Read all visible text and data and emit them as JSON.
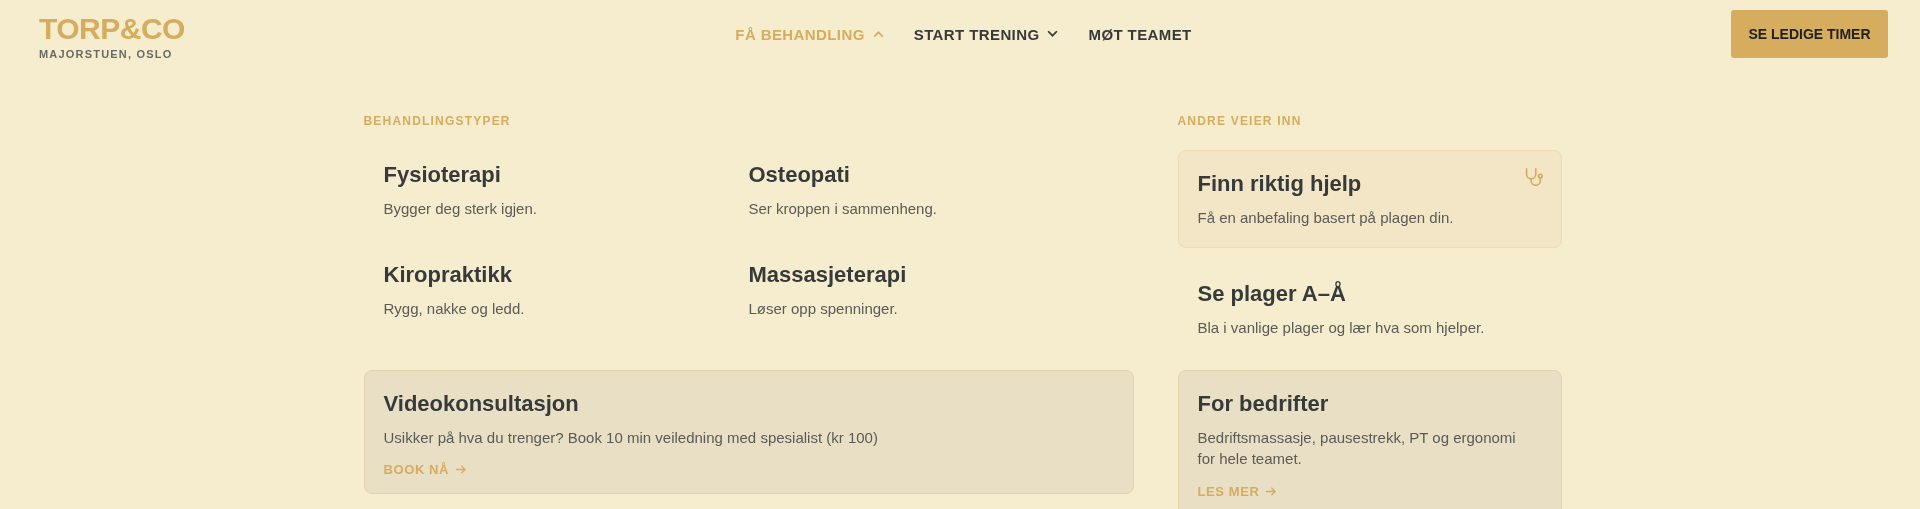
{
  "header": {
    "logo": "TORP&CO",
    "location": "MAJORSTUEN, OSLO",
    "nav": [
      {
        "label": "FÅ BEHANDLING",
        "kind": "dropdown",
        "selected": true,
        "expanded": true
      },
      {
        "label": "START TRENING",
        "kind": "dropdown",
        "selected": false,
        "expanded": false
      },
      {
        "label": "MØT TEAMET",
        "kind": "link",
        "selected": false
      }
    ],
    "cta": "SE LEDIGE TIMER"
  },
  "menu": {
    "treatments": {
      "heading": "BEHANDLINGSTYPER",
      "items": [
        {
          "title": "Fysioterapi",
          "text": "Bygger deg sterk igjen."
        },
        {
          "title": "Osteopati",
          "text": "Ser kroppen i sammenheng."
        },
        {
          "title": "Kiropraktikk",
          "text": "Rygg, nakke og ledd."
        },
        {
          "title": "Massasjeterapi",
          "text": "Løser opp spenninger."
        }
      ],
      "feature": {
        "title": "Videokonsultasjon",
        "text": "Usikker på hva du trenger? Book 10 min veiledning med spesialist (kr 100)",
        "link": "BOOK NÅ"
      }
    },
    "other": {
      "heading": "ANDRE VEIER INN",
      "items": [
        {
          "kind": "outlined",
          "title": "Finn riktig hjelp",
          "text": "Få en anbefaling basert på plagen din."
        },
        {
          "kind": "plain",
          "title": "Se plager A–Å",
          "text": "Bla i vanlige plager og lær hva som hjelper."
        },
        {
          "kind": "filled",
          "title": "For bedrifter",
          "text": "Bedriftsmassasje, pausestrekk, PT og ergonomi for hele teamet.",
          "link": "LES MER"
        }
      ]
    }
  }
}
